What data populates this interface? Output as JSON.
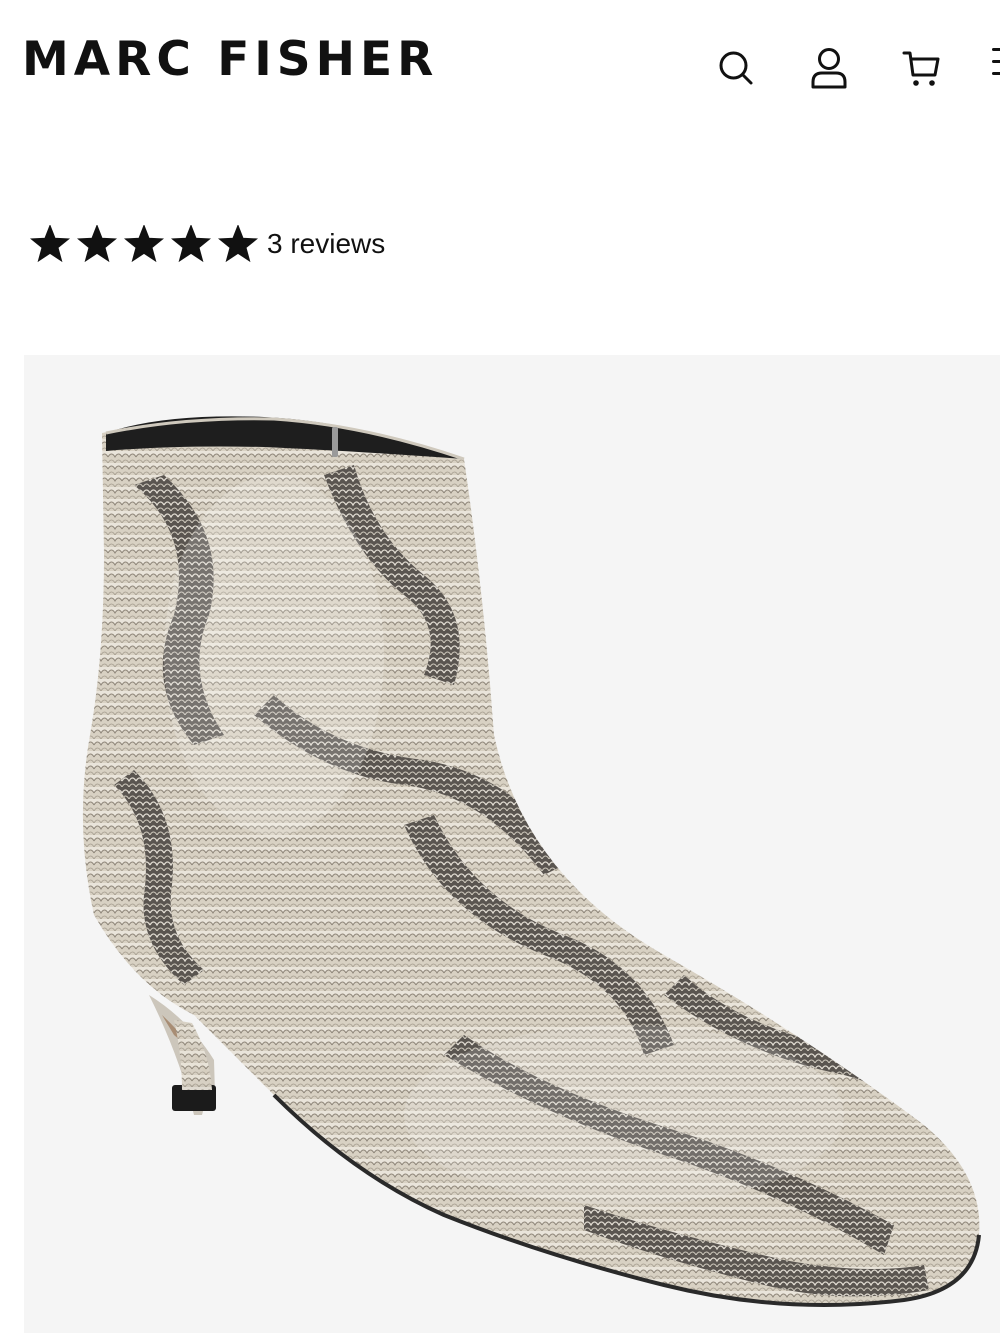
{
  "brand": {
    "name": "MARC FISHER"
  },
  "header": {
    "icons": {
      "search": "search-icon",
      "account": "user-icon",
      "cart": "cart-icon",
      "menu": "hamburger-icon"
    }
  },
  "rating": {
    "stars": 5,
    "max_stars": 5,
    "reviews_label": "3 reviews"
  },
  "product": {
    "image": "snakeskin-print-pointed-toe-kitten-heel-ankle-bootie",
    "image_background": "#f5f5f5"
  },
  "colors": {
    "text": "#111111",
    "background": "#ffffff"
  }
}
